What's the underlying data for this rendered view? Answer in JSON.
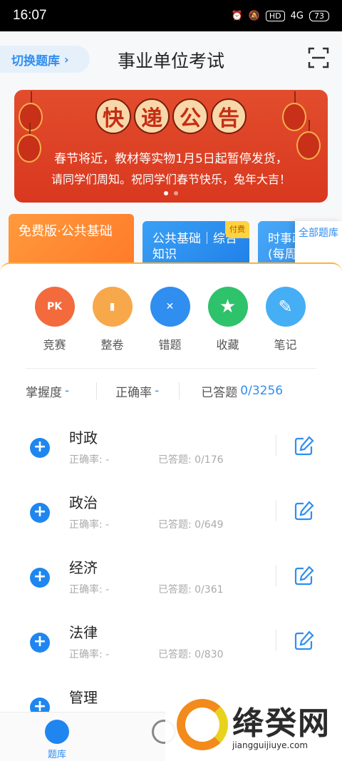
{
  "status_bar": {
    "time": "16:07",
    "hd": "HD",
    "signal": "4G",
    "battery": "73"
  },
  "header": {
    "switch_label": "切换题库",
    "title": "事业单位考试",
    "scan_icon": "scan-icon"
  },
  "banner": {
    "title_chars": [
      "快",
      "递",
      "公",
      "告"
    ],
    "line1": "春节将近，教材等实物1月5日起暂停发货，",
    "line2": "请同学们周知。祝同学们春节快乐，兔年大吉！"
  },
  "cards": [
    {
      "label": "免费版·公共基础"
    },
    {
      "label": "公共基础｜综合知识",
      "badge": "付费"
    },
    {
      "label": "时事政治(每周"
    }
  ],
  "all_library": "全部题库",
  "tools": [
    {
      "label": "竞赛",
      "icon": "pk-icon",
      "color": "#f36a3c",
      "glyph": "PK"
    },
    {
      "label": "整卷",
      "icon": "paper-icon",
      "color": "#f7a84a",
      "glyph": "▮"
    },
    {
      "label": "错题",
      "icon": "wrong-icon",
      "color": "#2f8ef0",
      "glyph": "✕"
    },
    {
      "label": "收藏",
      "icon": "star-icon",
      "color": "#2ec26a",
      "glyph": "★"
    },
    {
      "label": "笔记",
      "icon": "pen-icon",
      "color": "#45aef5",
      "glyph": "✎"
    }
  ],
  "stats": {
    "mastery_label": "掌握度",
    "mastery_value": "-",
    "accuracy_label": "正确率",
    "accuracy_value": "-",
    "answered_label": "已答题",
    "answered_value": "0/3256"
  },
  "subjects": [
    {
      "name": "时政",
      "accuracy": "正确率: -",
      "answered": "已答题: 0/176"
    },
    {
      "name": "政治",
      "accuracy": "正确率: -",
      "answered": "已答题: 0/649"
    },
    {
      "name": "经济",
      "accuracy": "正确率: -",
      "answered": "已答题: 0/361"
    },
    {
      "name": "法律",
      "accuracy": "正确率: -",
      "answered": "已答题: 0/830"
    },
    {
      "name": "管理",
      "accuracy": "",
      "answered": ""
    }
  ],
  "bottom_nav": [
    {
      "label": "题库"
    },
    {
      "label": ""
    }
  ],
  "watermark": {
    "brand": "绛癸网",
    "url": "jiangguijiuye.com"
  }
}
